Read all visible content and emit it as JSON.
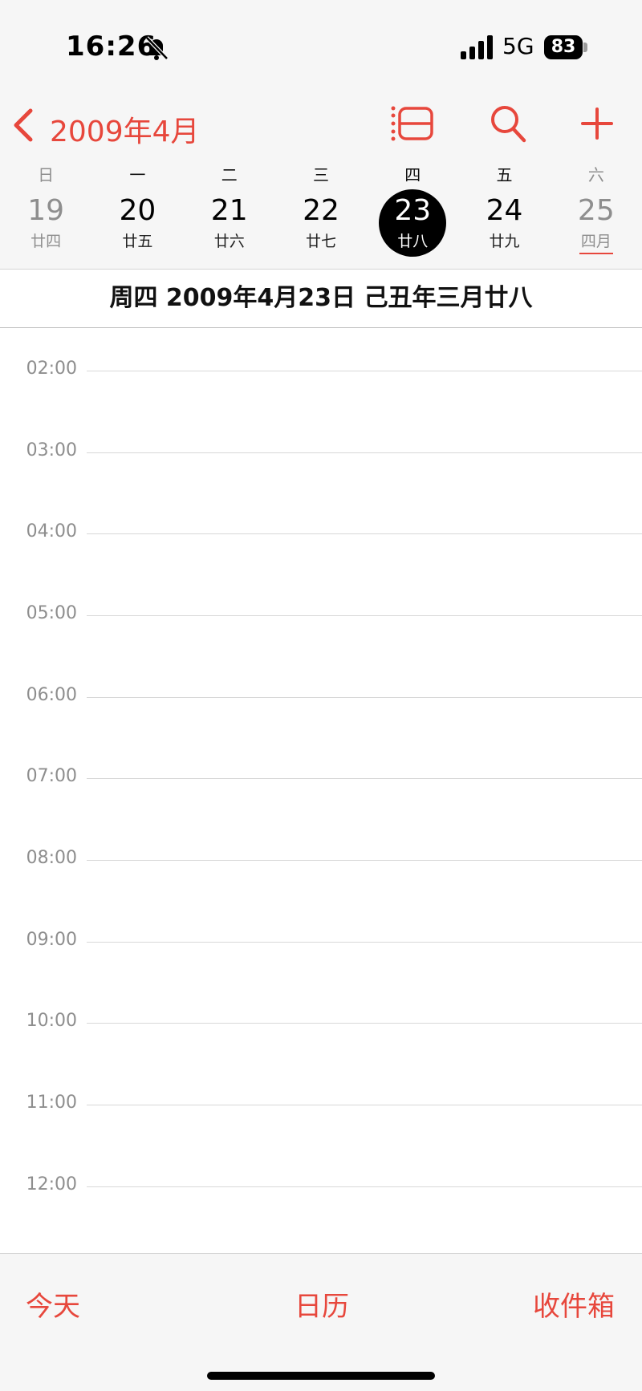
{
  "status_bar": {
    "time": "16:26",
    "network": "5G",
    "battery": "83"
  },
  "nav": {
    "back_label": "2009年4月",
    "accent_color": "#e7473c",
    "icons": [
      "list-view-icon",
      "search-icon",
      "add-icon"
    ]
  },
  "week": {
    "weekdays": [
      "日",
      "一",
      "二",
      "三",
      "四",
      "五",
      "六"
    ],
    "days": [
      {
        "num": "19",
        "lunar": "廿四"
      },
      {
        "num": "20",
        "lunar": "廿五"
      },
      {
        "num": "21",
        "lunar": "廿六"
      },
      {
        "num": "22",
        "lunar": "廿七"
      },
      {
        "num": "23",
        "lunar": "廿八"
      },
      {
        "num": "24",
        "lunar": "廿九"
      },
      {
        "num": "25",
        "lunar": "四月"
      }
    ]
  },
  "date_header": "周四 2009年4月23日  己丑年三月廿八",
  "timeline": {
    "hours": [
      "02:00",
      "03:00",
      "04:00",
      "05:00",
      "06:00",
      "07:00",
      "08:00",
      "09:00",
      "10:00",
      "11:00",
      "12:00"
    ]
  },
  "tabbar": {
    "today": "今天",
    "calendars": "日历",
    "inbox": "收件箱"
  }
}
